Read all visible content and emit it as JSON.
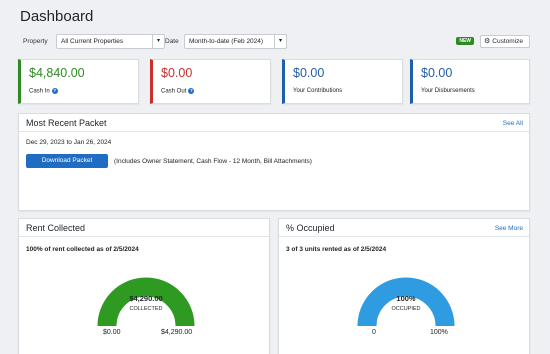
{
  "page": {
    "title": "Dashboard"
  },
  "filters": {
    "property_label": "Property",
    "property_value": "All Current Properties",
    "date_label": "Date",
    "date_value": "Month-to-date (Feb 2024)",
    "new_badge": "NEW",
    "customize_label": "Customize"
  },
  "summary_cards": [
    {
      "amount": "$4,840.00",
      "label": "Cash In",
      "has_info": true,
      "color": "#2e8b22"
    },
    {
      "amount": "$0.00",
      "label": "Cash Out",
      "has_info": true,
      "color": "#c9302c"
    },
    {
      "amount": "$0.00",
      "label": "Your Contributions",
      "has_info": false,
      "color": "#1e5fa8"
    },
    {
      "amount": "$0.00",
      "label": "Your Disbursements",
      "has_info": false,
      "color": "#1e5fa8"
    }
  ],
  "packet": {
    "title": "Most Recent Packet",
    "link": "See All",
    "range": "Dec 29, 2023 to Jan 26, 2024",
    "button": "Download Packet",
    "note": "(Includes Owner Statement, Cash Flow - 12 Month, Bill Attachments)"
  },
  "rent": {
    "title": "Rent Collected",
    "caption": "100% of rent collected as of 2/5/2024",
    "center_value": "$4,290.00",
    "center_label": "COLLECTED",
    "min_label": "$0.00",
    "max_label": "$4,290.00",
    "fill_fraction": 1.0,
    "color": "#2e9a22"
  },
  "occupied": {
    "title": "% Occupied",
    "link": "See More",
    "caption": "3 of 3 units rented as of 2/5/2024",
    "center_value": "100%",
    "center_label": "OCCUPIED",
    "min_label": "0",
    "max_label": "100%",
    "fill_fraction": 1.0,
    "color": "#2f9be0"
  },
  "icons": {
    "info": "info-icon",
    "gear": "gear-icon",
    "caret": "chevron-down-icon"
  }
}
